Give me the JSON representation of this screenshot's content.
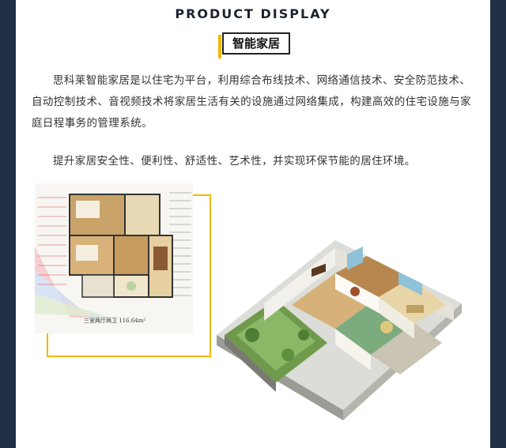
{
  "header": {
    "title": "PRODUCT DISPLAY"
  },
  "badge": {
    "label": "智能家居"
  },
  "content": {
    "paragraph_1": "思科莱智能家居是以住宅为平台，利用综合布线技术、网络通信技术、安全防范技术、自动控制技术、音视频技术将家居生活有关的设施通过网络集成，构建高效的住宅设施与家庭日程事务的管理系统。",
    "paragraph_2": "提升家居安全性、便利性、舒适性、艺术性，并实现环保节能的居住环境。"
  },
  "floor_plan": {
    "caption": "三室两厅两卫    116.64m²"
  },
  "colors": {
    "background": "#1f3047",
    "accent": "#f2b600",
    "text": "#333333"
  }
}
